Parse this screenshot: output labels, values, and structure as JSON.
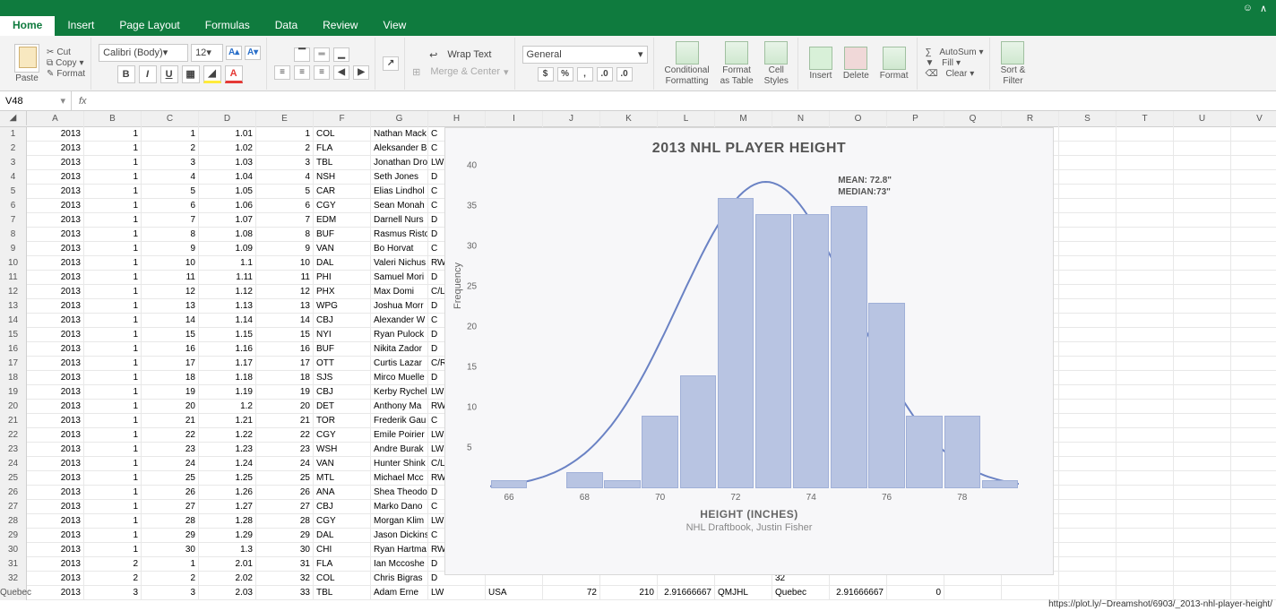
{
  "titlebar": {
    "smile": "☺",
    "caret": "∧"
  },
  "tabs": [
    "Home",
    "Insert",
    "Page Layout",
    "Formulas",
    "Data",
    "Review",
    "View"
  ],
  "active_tab": 0,
  "ribbon": {
    "paste": "Paste",
    "cut": "Cut",
    "copy": "Copy",
    "format": "Format",
    "font": "Calibri (Body)",
    "fontsize": "12",
    "wrap": "Wrap Text",
    "merge": "Merge & Center",
    "numformat": "General",
    "cond": "Conditional",
    "cond2": "Formatting",
    "fastable": "Format",
    "fastable2": "as Table",
    "cellstyles": "Cell",
    "cellstyles2": "Styles",
    "insert": "Insert",
    "delete": "Delete",
    "formatbtn": "Format",
    "autosum": "AutoSum",
    "fill": "Fill",
    "clear": "Clear",
    "sortfilter": "Sort &",
    "sortfilter2": "Filter"
  },
  "namebox": "V48",
  "columns": [
    "A",
    "B",
    "C",
    "D",
    "E",
    "F",
    "G",
    "H",
    "I",
    "J",
    "K",
    "L",
    "M",
    "N",
    "O",
    "P",
    "Q",
    "R",
    "S",
    "T",
    "U",
    "V"
  ],
  "sheet": {
    "rows": [
      {
        "n": 1,
        "a": "2013",
        "b": "1",
        "c": "1",
        "d": "1.01",
        "e": "1",
        "f": "COL",
        "g": "Nathan Mack",
        "h": "C"
      },
      {
        "n": 2,
        "a": "2013",
        "b": "1",
        "c": "2",
        "d": "1.02",
        "e": "2",
        "f": "FLA",
        "g": "Aleksander B",
        "h": "C"
      },
      {
        "n": 3,
        "a": "2013",
        "b": "1",
        "c": "3",
        "d": "1.03",
        "e": "3",
        "f": "TBL",
        "g": "Jonathan Dro",
        "h": "LW"
      },
      {
        "n": 4,
        "a": "2013",
        "b": "1",
        "c": "4",
        "d": "1.04",
        "e": "4",
        "f": "NSH",
        "g": "Seth Jones",
        "h": "D"
      },
      {
        "n": 5,
        "a": "2013",
        "b": "1",
        "c": "5",
        "d": "1.05",
        "e": "5",
        "f": "CAR",
        "g": "Elias Lindhol",
        "h": "C"
      },
      {
        "n": 6,
        "a": "2013",
        "b": "1",
        "c": "6",
        "d": "1.06",
        "e": "6",
        "f": "CGY",
        "g": "Sean Monah",
        "h": "C"
      },
      {
        "n": 7,
        "a": "2013",
        "b": "1",
        "c": "7",
        "d": "1.07",
        "e": "7",
        "f": "EDM",
        "g": "Darnell Nurs",
        "h": "D"
      },
      {
        "n": 8,
        "a": "2013",
        "b": "1",
        "c": "8",
        "d": "1.08",
        "e": "8",
        "f": "BUF",
        "g": "Rasmus Risto",
        "h": "D"
      },
      {
        "n": 9,
        "a": "2013",
        "b": "1",
        "c": "9",
        "d": "1.09",
        "e": "9",
        "f": "VAN",
        "g": "Bo Horvat",
        "h": "C"
      },
      {
        "n": 10,
        "a": "2013",
        "b": "1",
        "c": "10",
        "d": "1.1",
        "e": "10",
        "f": "DAL",
        "g": "Valeri Nichus",
        "h": "RW"
      },
      {
        "n": 11,
        "a": "2013",
        "b": "1",
        "c": "11",
        "d": "1.11",
        "e": "11",
        "f": "PHI",
        "g": "Samuel Mori",
        "h": "D"
      },
      {
        "n": 12,
        "a": "2013",
        "b": "1",
        "c": "12",
        "d": "1.12",
        "e": "12",
        "f": "PHX",
        "g": "Max Domi",
        "h": "C/L"
      },
      {
        "n": 13,
        "a": "2013",
        "b": "1",
        "c": "13",
        "d": "1.13",
        "e": "13",
        "f": "WPG",
        "g": "Joshua Morr",
        "h": "D"
      },
      {
        "n": 14,
        "a": "2013",
        "b": "1",
        "c": "14",
        "d": "1.14",
        "e": "14",
        "f": "CBJ",
        "g": "Alexander W",
        "h": "C"
      },
      {
        "n": 15,
        "a": "2013",
        "b": "1",
        "c": "15",
        "d": "1.15",
        "e": "15",
        "f": "NYI",
        "g": "Ryan Pulock",
        "h": "D"
      },
      {
        "n": 16,
        "a": "2013",
        "b": "1",
        "c": "16",
        "d": "1.16",
        "e": "16",
        "f": "BUF",
        "g": "Nikita Zador",
        "h": "D"
      },
      {
        "n": 17,
        "a": "2013",
        "b": "1",
        "c": "17",
        "d": "1.17",
        "e": "17",
        "f": "OTT",
        "g": "Curtis Lazar",
        "h": "C/R"
      },
      {
        "n": 18,
        "a": "2013",
        "b": "1",
        "c": "18",
        "d": "1.18",
        "e": "18",
        "f": "SJS",
        "g": "Mirco Muelle",
        "h": "D"
      },
      {
        "n": 19,
        "a": "2013",
        "b": "1",
        "c": "19",
        "d": "1.19",
        "e": "19",
        "f": "CBJ",
        "g": "Kerby Rychel",
        "h": "LW"
      },
      {
        "n": 20,
        "a": "2013",
        "b": "1",
        "c": "20",
        "d": "1.2",
        "e": "20",
        "f": "DET",
        "g": "Anthony Ma",
        "h": "RW"
      },
      {
        "n": 21,
        "a": "2013",
        "b": "1",
        "c": "21",
        "d": "1.21",
        "e": "21",
        "f": "TOR",
        "g": "Frederik Gau",
        "h": "C"
      },
      {
        "n": 22,
        "a": "2013",
        "b": "1",
        "c": "22",
        "d": "1.22",
        "e": "22",
        "f": "CGY",
        "g": "Emile Poirier",
        "h": "LW"
      },
      {
        "n": 23,
        "a": "2013",
        "b": "1",
        "c": "23",
        "d": "1.23",
        "e": "23",
        "f": "WSH",
        "g": "Andre Burak",
        "h": "LW"
      },
      {
        "n": 24,
        "a": "2013",
        "b": "1",
        "c": "24",
        "d": "1.24",
        "e": "24",
        "f": "VAN",
        "g": "Hunter Shink",
        "h": "C/L"
      },
      {
        "n": 25,
        "a": "2013",
        "b": "1",
        "c": "25",
        "d": "1.25",
        "e": "25",
        "f": "MTL",
        "g": "Michael Mcc",
        "h": "RW"
      },
      {
        "n": 26,
        "a": "2013",
        "b": "1",
        "c": "26",
        "d": "1.26",
        "e": "26",
        "f": "ANA",
        "g": "Shea Theodo",
        "h": "D"
      },
      {
        "n": 27,
        "a": "2013",
        "b": "1",
        "c": "27",
        "d": "1.27",
        "e": "27",
        "f": "CBJ",
        "g": "Marko Dano",
        "h": "C"
      },
      {
        "n": 28,
        "a": "2013",
        "b": "1",
        "c": "28",
        "d": "1.28",
        "e": "28",
        "f": "CGY",
        "g": "Morgan Klim",
        "h": "LW"
      },
      {
        "n": 29,
        "a": "2013",
        "b": "1",
        "c": "29",
        "d": "1.29",
        "e": "29",
        "f": "DAL",
        "g": "Jason Dickins",
        "h": "C"
      },
      {
        "n": 30,
        "a": "2013",
        "b": "1",
        "c": "30",
        "d": "1.3",
        "e": "30",
        "f": "CHI",
        "g": "Ryan Hartma",
        "h": "RW"
      },
      {
        "n": 31,
        "a": "2013",
        "b": "2",
        "c": "1",
        "d": "2.01",
        "e": "31",
        "f": "FLA",
        "g": "Ian Mccoshe",
        "h": "D"
      },
      {
        "n": 32,
        "a": "2013",
        "b": "2",
        "c": "2",
        "d": "2.02",
        "e": "32",
        "f": "COL",
        "g": "Chris Bigras",
        "h": "D"
      },
      {
        "n": "Quebec",
        "a": "2013",
        "b": "3",
        "c": "3",
        "d": "2.03",
        "e": "33",
        "f": "TBL",
        "g": "Adam Erne",
        "h": "LW",
        "i": "USA",
        "j": "72",
        "k": "210",
        "l": "2.91666667",
        "m": "QMJHL",
        "o": "2.91666667",
        "p": "0"
      }
    ]
  },
  "chart_data": {
    "type": "bar",
    "title": "2013 NHL PLAYER HEIGHT",
    "xlabel": "HEIGHT (INCHES)",
    "ylabel": "Frequency",
    "subtitle": "NHL Draftbook, Justin Fisher",
    "categories": [
      66,
      67,
      68,
      69,
      70,
      71,
      72,
      73,
      74,
      75,
      76,
      77,
      78,
      79
    ],
    "values": [
      1,
      0,
      2,
      1,
      9,
      14,
      36,
      34,
      34,
      35,
      23,
      9,
      9,
      1
    ],
    "xticks": [
      66,
      68,
      70,
      72,
      74,
      76,
      78
    ],
    "yticks": [
      5,
      10,
      15,
      20,
      25,
      30,
      35,
      40
    ],
    "ylim": [
      0,
      40
    ],
    "annotation_mean": "MEAN: 72.8\"",
    "annotation_median": "MEDIAN:73\"",
    "overlay": "normal-curve"
  },
  "footer_link": "https://plot.ly/~Dreamshot/6903/_2013-nhl-player-height/"
}
